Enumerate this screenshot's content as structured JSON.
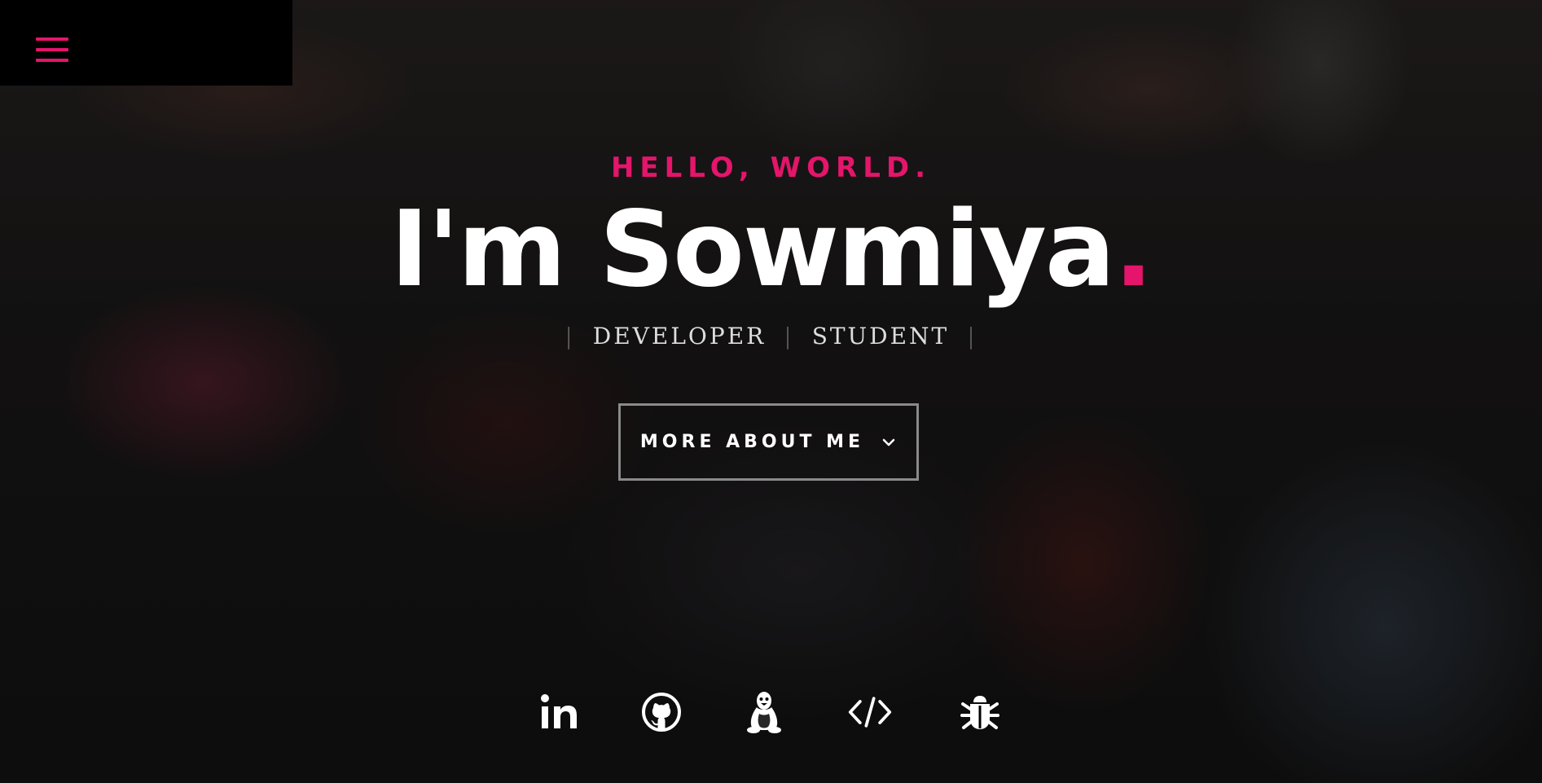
{
  "menu": {
    "icon": "hamburger-menu-icon",
    "color": "#e4156b"
  },
  "hero": {
    "greeting": "HELLO, WORLD.",
    "name_text": "I'm Sowmiya",
    "name_dot": ".",
    "roles": [
      "DEVELOPER",
      "STUDENT"
    ],
    "role_separator": "|",
    "cta_label": "MORE ABOUT ME",
    "cta_icon": "chevron-down-icon"
  },
  "socials": [
    {
      "icon": "linkedin-icon",
      "label": "in"
    },
    {
      "icon": "github-icon"
    },
    {
      "icon": "linux-tux-icon"
    },
    {
      "icon": "code-icon"
    },
    {
      "icon": "bug-icon"
    }
  ],
  "colors": {
    "accent": "#e4156b",
    "text": "#ffffff",
    "menu_bg": "#000000"
  }
}
